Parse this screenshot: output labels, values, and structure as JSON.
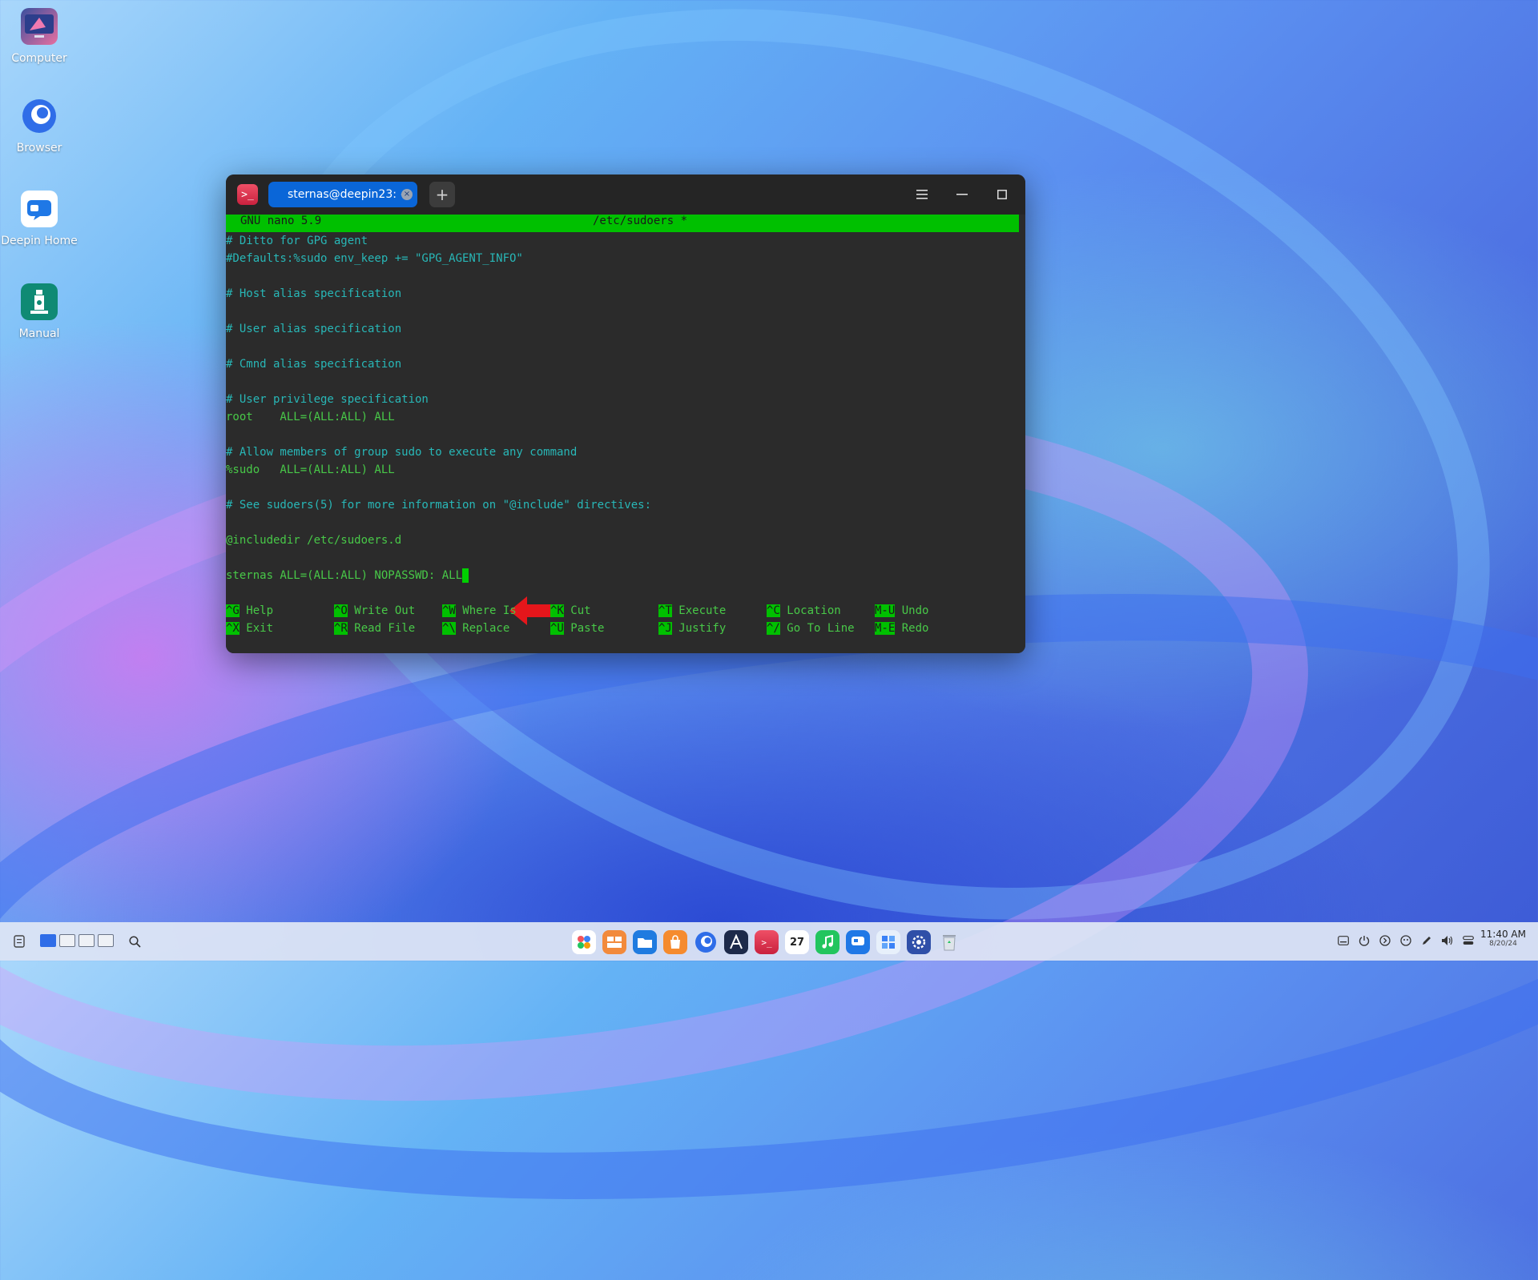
{
  "desktop": {
    "icons": [
      {
        "label": "Computer"
      },
      {
        "label": "Browser"
      },
      {
        "label": "Deepin Home"
      },
      {
        "label": "Manual"
      }
    ]
  },
  "terminal": {
    "tab_title": "sternas@deepin23: ~",
    "tab_close_glyph": "×",
    "new_tab_glyph": "+",
    "nano": {
      "version": "GNU nano 5.9",
      "filename": "/etc/sudoers *"
    },
    "lines": [
      {
        "text": "# Ditto for GPG agent",
        "color": "#28b7b7"
      },
      {
        "text": "#Defaults:%sudo env_keep += \"GPG_AGENT_INFO\"",
        "color": "#28b7b7"
      },
      {
        "text": "",
        "color": "#28b7b7"
      },
      {
        "text": "# Host alias specification",
        "color": "#28b7b7"
      },
      {
        "text": "",
        "color": "#28b7b7"
      },
      {
        "text": "# User alias specification",
        "color": "#28b7b7"
      },
      {
        "text": "",
        "color": "#28b7b7"
      },
      {
        "text": "# Cmnd alias specification",
        "color": "#28b7b7"
      },
      {
        "text": "",
        "color": "#28b7b7"
      },
      {
        "text": "# User privilege specification",
        "color": "#28b7b7"
      },
      {
        "text": "root    ALL=(ALL:ALL) ALL",
        "color": "#48c848"
      },
      {
        "text": "",
        "color": "#28b7b7"
      },
      {
        "text": "# Allow members of group sudo to execute any command",
        "color": "#28b7b7"
      },
      {
        "text": "%sudo   ALL=(ALL:ALL) ALL",
        "color": "#48c848"
      },
      {
        "text": "",
        "color": "#28b7b7"
      },
      {
        "text": "# See sudoers(5) for more information on \"@include\" directives:",
        "color": "#28b7b7"
      },
      {
        "text": "",
        "color": "#28b7b7"
      },
      {
        "text": "@includedir /etc/sudoers.d",
        "color": "#48c848"
      },
      {
        "text": "",
        "color": "#28b7b7"
      },
      {
        "text": "sternas ALL=(ALL:ALL) NOPASSWD: ALL",
        "color": "#48c848"
      }
    ],
    "shortcuts_row1": [
      {
        "key": "^G",
        "label": "Help"
      },
      {
        "key": "^O",
        "label": "Write Out"
      },
      {
        "key": "^W",
        "label": "Where Is"
      },
      {
        "key": "^K",
        "label": "Cut"
      },
      {
        "key": "^T",
        "label": "Execute"
      },
      {
        "key": "^C",
        "label": "Location"
      },
      {
        "key": "M-U",
        "label": "Undo"
      }
    ],
    "shortcuts_row2": [
      {
        "key": "^X",
        "label": "Exit"
      },
      {
        "key": "^R",
        "label": "Read File"
      },
      {
        "key": "^\\",
        "label": "Replace"
      },
      {
        "key": "^U",
        "label": "Paste"
      },
      {
        "key": "^J",
        "label": "Justify"
      },
      {
        "key": "^/",
        "label": "Go To Line"
      },
      {
        "key": "M-E",
        "label": "Redo"
      }
    ]
  },
  "taskbar": {
    "clock_time": "11:40 AM",
    "clock_date": "8/20/24",
    "calendar_day": "27",
    "dock_apps": [
      "launcher-icon",
      "multitasking-icon",
      "file-manager-icon",
      "app-store-icon",
      "browser-icon",
      "text-editor-icon",
      "terminal-icon",
      "calendar-icon",
      "music-icon",
      "deepin-home-icon",
      "control-panel-icon",
      "settings-icon",
      "trash-icon"
    ]
  },
  "colors": {
    "nano_green": "#00c000",
    "comment_cyan": "#28b7b7",
    "code_green": "#48c848",
    "tab_blue": "#0a66d8",
    "arrow_red": "#e5161b"
  }
}
